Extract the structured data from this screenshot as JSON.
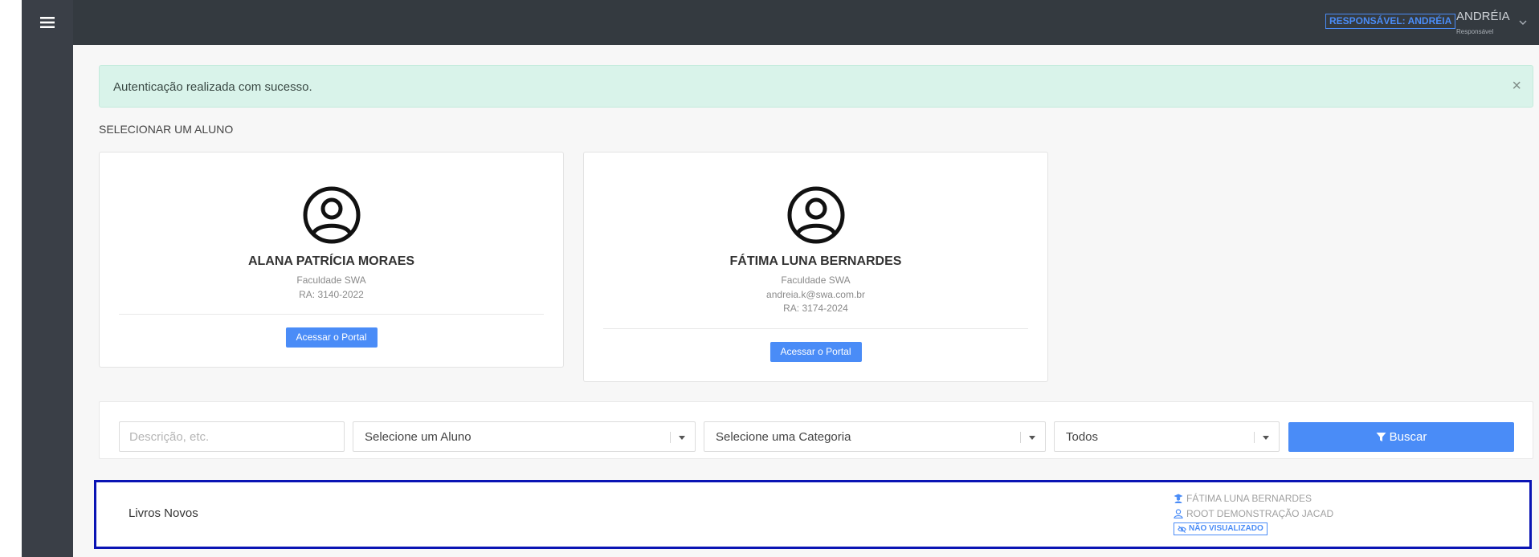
{
  "header": {
    "responsible_badge": "RESPONSÁVEL: ANDRÉIA",
    "user_name": "ANDRÉIA",
    "user_role": "Responsável"
  },
  "alert": {
    "message": "Autenticação realizada com sucesso.",
    "close_label": "×"
  },
  "section_title": "SELECIONAR UM ALUNO",
  "students": [
    {
      "name": "ALANA PATRÍCIA MORAES",
      "institution": "Faculdade SWA",
      "ra": "RA: 3140-2022",
      "button_label": "Acessar o Portal"
    },
    {
      "name": "FÁTIMA LUNA BERNARDES",
      "institution": "Faculdade SWA",
      "email": "andreia.k@swa.com.br",
      "ra": "RA: 3174-2024",
      "button_label": "Acessar o Portal"
    }
  ],
  "filters": {
    "description_placeholder": "Descrição, etc.",
    "student_select": "Selecione um Aluno",
    "category_select": "Selecione uma Categoria",
    "status_select": "Todos",
    "search_label": "Buscar"
  },
  "records": [
    {
      "title": "Livros Novos",
      "student": "FÁTIMA LUNA BERNARDES",
      "author": "ROOT DEMONSTRAÇÃO JACAD",
      "status": "NÃO VISUALIZADO"
    }
  ],
  "colors": {
    "accent": "#4a8cf7",
    "topbar": "#343a40",
    "sidebar": "#3a3f47",
    "alert_bg": "#d9f3ea",
    "highlight_border": "#0a14b4"
  }
}
